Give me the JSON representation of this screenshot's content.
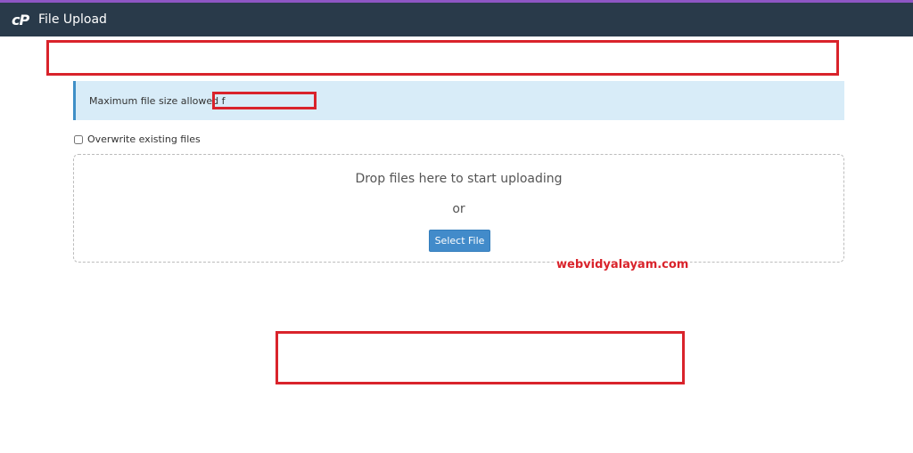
{
  "header": {
    "logo_text": "cP",
    "title": "File Upload"
  },
  "info": {
    "text": "Maximum file size allowed f"
  },
  "overwrite": {
    "label": "Overwrite existing files",
    "checked": false
  },
  "dropzone": {
    "drop_text": "Drop files here to start uploading",
    "or_text": "or",
    "select_label": "Select File"
  },
  "watermark": {
    "text": "webvidyalayam.com"
  },
  "colors": {
    "header_bg": "#293a4a",
    "accent": "#8e56c4",
    "info_bg": "#d8ecf8",
    "button_bg": "#428bca",
    "redaction": "#d9232b"
  }
}
